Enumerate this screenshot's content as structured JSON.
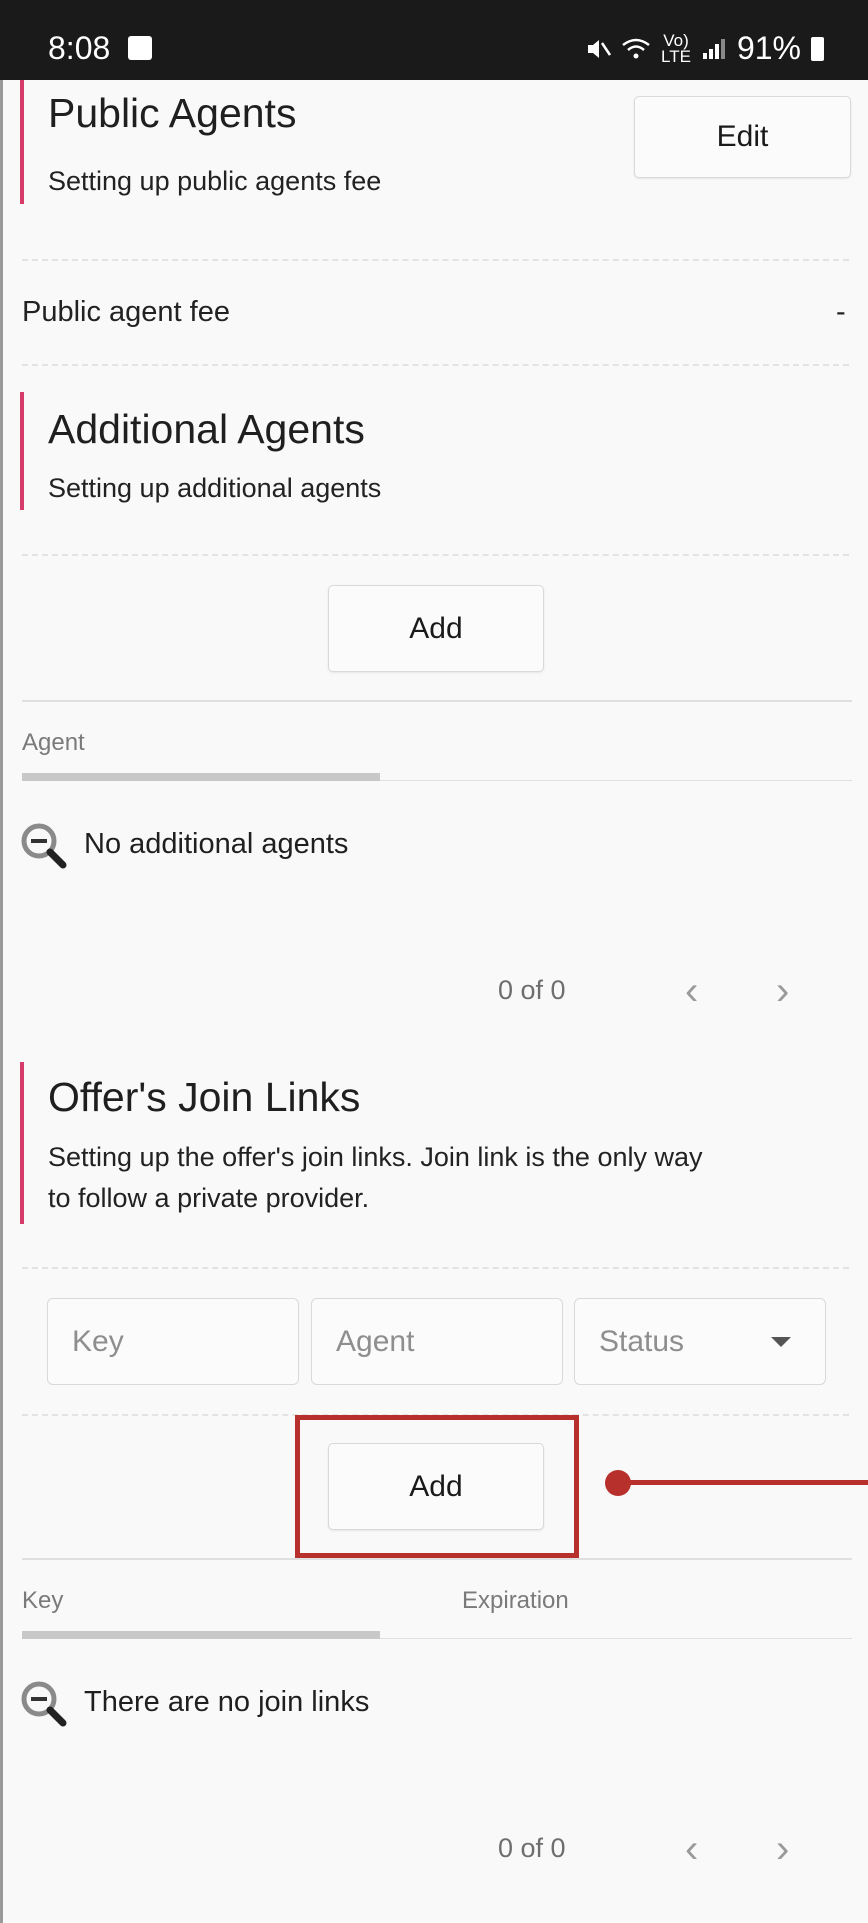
{
  "status_bar": {
    "time": "8:08",
    "volte_top": "Vo)",
    "volte_bottom": "LTE",
    "battery": "91%"
  },
  "public_agents": {
    "title": "Public Agents",
    "description": "Setting up public agents fee",
    "edit_label": "Edit",
    "fee_label": "Public agent fee",
    "fee_value": "-"
  },
  "additional_agents": {
    "title": "Additional Agents",
    "description": "Setting up additional agents",
    "add_label": "Add",
    "column": "Agent",
    "empty": "No additional agents",
    "pagination": "0 of 0"
  },
  "join_links": {
    "title": "Offer's Join Links",
    "description_line1": "Setting up the offer's join links. Join link is the only way",
    "description_line2": "to follow a private provider.",
    "key_placeholder": "Key",
    "agent_placeholder": "Agent",
    "status_value": "Status",
    "add_label": "Add",
    "columns": [
      "Key",
      "Expiration"
    ],
    "empty": "There are no join links",
    "pagination": "0 of 0"
  },
  "colors": {
    "accent": "#d63c6a",
    "highlight": "#b8302b"
  }
}
